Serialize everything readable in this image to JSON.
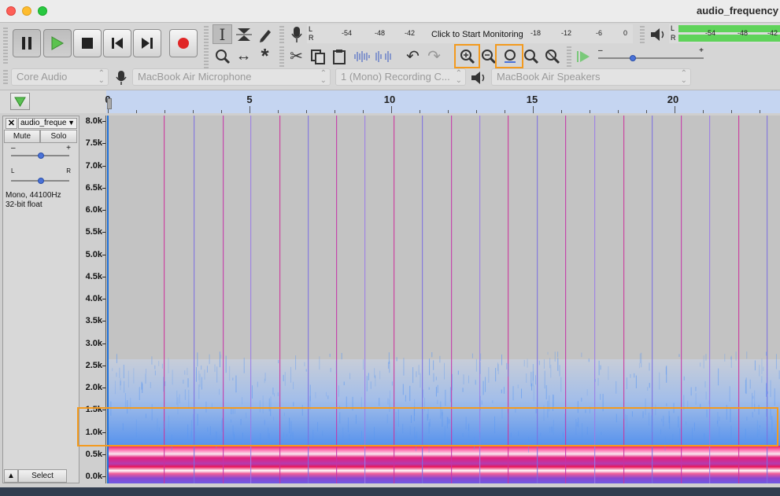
{
  "window": {
    "title": "audio_frequency"
  },
  "transport": {
    "buttons": [
      {
        "name": "pause-button",
        "icon": "pause-icon"
      },
      {
        "name": "play-button",
        "icon": "play-icon"
      },
      {
        "name": "stop-button",
        "icon": "stop-icon"
      },
      {
        "name": "skip-start-button",
        "icon": "skip-start-icon"
      },
      {
        "name": "skip-end-button",
        "icon": "skip-end-icon"
      },
      {
        "name": "record-button",
        "icon": "record-icon"
      }
    ]
  },
  "meters": {
    "recording_prompt": "Click to Start Monitoring",
    "rec_scale": [
      "-54",
      "-48",
      "-42",
      "-18",
      "-12",
      "-6",
      "0"
    ],
    "play_scale": [
      "-54",
      "-48",
      "-42"
    ],
    "channel_left": "L",
    "channel_right": "R"
  },
  "devices": {
    "host": "Core Audio",
    "input": "MacBook Air Microphone",
    "channels": "1 (Mono) Recording C...",
    "output": "MacBook Air Speakers"
  },
  "timeline": {
    "ticks": [
      "0",
      "5",
      "10",
      "15",
      "20"
    ]
  },
  "track": {
    "name": "audio_freque",
    "mute": "Mute",
    "solo": "Solo",
    "gain_minus": "–",
    "gain_plus": "+",
    "pan_left": "L",
    "pan_right": "R",
    "format_line1": "Mono, 44100Hz",
    "format_line2": "32-bit float",
    "select": "Select"
  },
  "spectrogram": {
    "freq_labels": [
      "8.0k",
      "7.5k",
      "7.0k",
      "6.5k",
      "6.0k",
      "5.5k",
      "5.0k",
      "4.5k",
      "4.0k",
      "3.5k",
      "3.0k",
      "2.5k",
      "2.0k",
      "1.5k",
      "1.0k",
      "0.5k",
      "0.0k"
    ]
  },
  "colors": {
    "highlight": "#f39a1e",
    "ruler_bg": "#c5d5f1",
    "spectro_blue": "#4a8ff0",
    "spectro_pink": "#e8389a",
    "spectro_purple": "#7a4fd8"
  }
}
